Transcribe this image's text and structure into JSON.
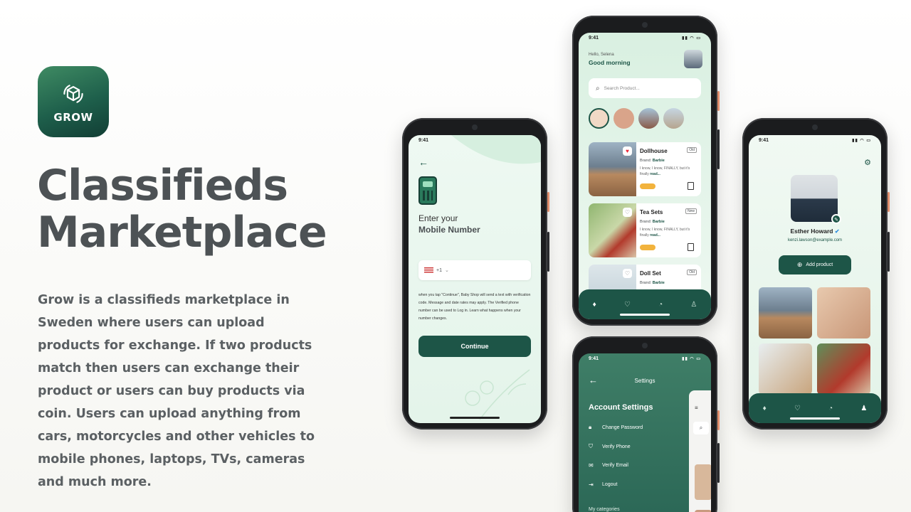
{
  "brand": {
    "logo_text": "GROW",
    "title_line1": "Classifieds",
    "title_line2": "Marketplace",
    "description": "Grow is a classifieds marketplace in Sweden where users can upload products for exchange. If two products match then users can exchange their product or users can buy products via coin. Users can upload anything from cars, motorcycles and other vehicles to mobile phones, laptops, TVs, cameras and much more."
  },
  "colors": {
    "accent": "#1d5547",
    "background": "#eaf7ee"
  },
  "status_time": "9:41",
  "login": {
    "prompt": "Enter your",
    "prompt_bold": "Mobile Number",
    "country_code": "+1",
    "legal": "when you tap \"Continue\", Baby Shop will send a text with verification code. Message and date rates may apply. The Verified phone number can be used to Log in. Learn what happens when your number changes.",
    "continue_label": "Continue"
  },
  "home": {
    "greeting": "Hello, Selena",
    "greeting_bold": "Good morning",
    "search_placeholder": "Search Product...",
    "products": [
      {
        "name": "Dollhouse",
        "tag": "Old",
        "brand_label": "Brand:",
        "brand": "Barbie",
        "desc": "I know, I know, FINALLY, but it's finally",
        "more": "read..."
      },
      {
        "name": "Tea Sets",
        "tag": "New",
        "brand_label": "Brand:",
        "brand": "Barbie",
        "desc": "I know, I know, FINALLY, but it's finally",
        "more": "read..."
      },
      {
        "name": "Doll Set",
        "tag": "Old",
        "brand_label": "Brand:",
        "brand": "Barbie",
        "desc": "",
        "more": ""
      }
    ]
  },
  "settings": {
    "title": "Settings",
    "section": "Account Settings",
    "items": [
      "Change Password",
      "Verify Phone",
      "Verify Email",
      "Logout"
    ],
    "sub_section": "My categories"
  },
  "profile": {
    "name": "Esther Howard",
    "email": "kenzi.lawson@example.com",
    "add_label": "Add product"
  }
}
